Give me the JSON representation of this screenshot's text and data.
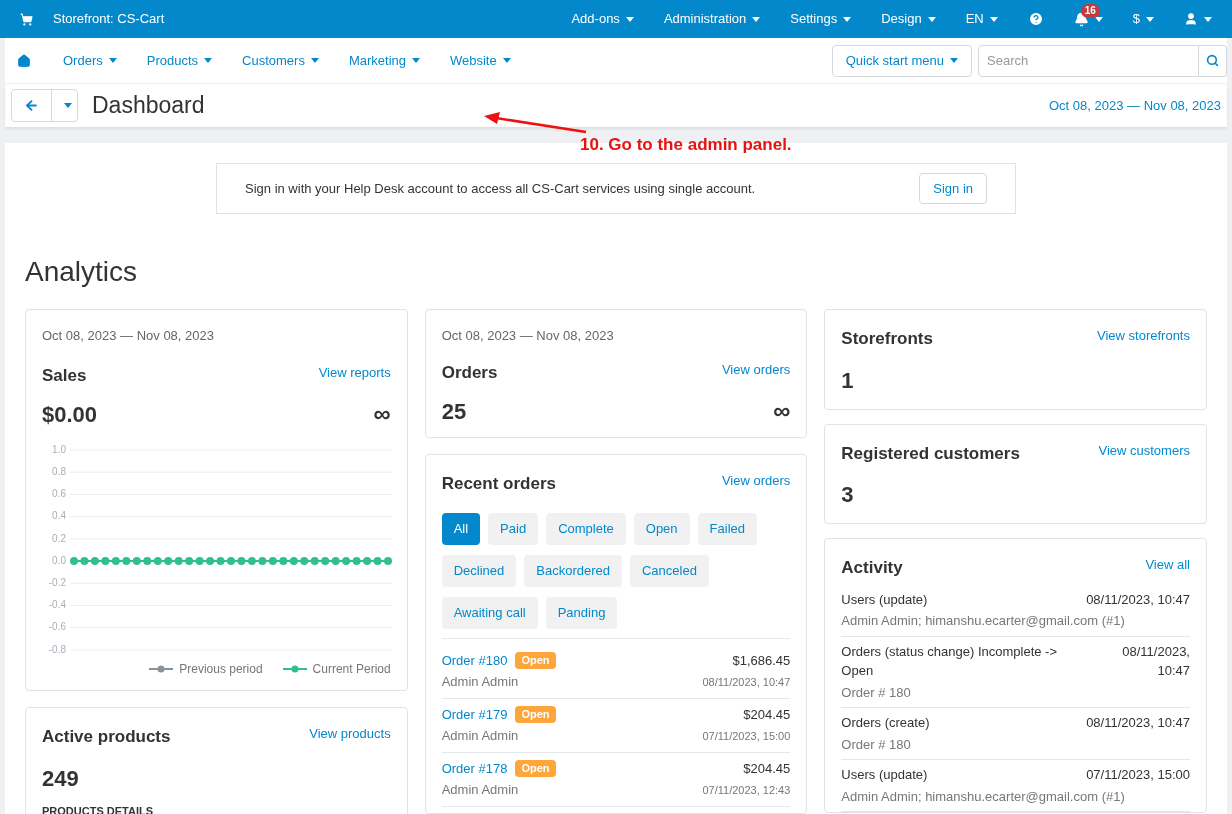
{
  "topbar": {
    "storefront": "Storefront: CS-Cart",
    "menus": [
      "Add-ons",
      "Administration",
      "Settings",
      "Design",
      "EN"
    ],
    "notifications": "16",
    "currency": "$"
  },
  "nav": {
    "items": [
      "Orders",
      "Products",
      "Customers",
      "Marketing",
      "Website"
    ],
    "quick_start": "Quick start menu",
    "search": {
      "placeholder": "Search"
    }
  },
  "header": {
    "title": "Dashboard",
    "date_range": "Oct 08, 2023 — Nov 08, 2023"
  },
  "annotation": {
    "text": "10. Go to the admin panel."
  },
  "signin_banner": {
    "text": "Sign in with your Help Desk account to access all CS-Cart services using single account.",
    "button": "Sign in"
  },
  "section_title": "Analytics",
  "sales": {
    "dates": "Oct 08, 2023 — Nov 08, 2023",
    "title": "Sales",
    "link": "View reports",
    "value": "$0.00",
    "change": "∞",
    "chart_data": {
      "type": "line",
      "ylim": [
        -0.8,
        1
      ],
      "yticks": [
        -0.8,
        -0.6,
        -0.4,
        -0.2,
        {
          "value": 0,
          "label": "0.0"
        },
        0.2,
        0.4,
        0.6,
        0.8,
        {
          "value": 1,
          "label": "1.0"
        }
      ],
      "grid": true,
      "legend": "lower right",
      "series": [
        {
          "name": "Previous period",
          "color": "#8a929a",
          "values": [
            null,
            null,
            null,
            null,
            null,
            null,
            null,
            null,
            null,
            null,
            null,
            null,
            null,
            null,
            null,
            null,
            null,
            null,
            null,
            null,
            null,
            null,
            null,
            null,
            null,
            null,
            null,
            null,
            null,
            null,
            null
          ]
        },
        {
          "name": "Current Period",
          "color": "#2fc08b",
          "marker": "circle",
          "values": [
            0,
            0,
            0,
            0,
            0,
            0,
            0,
            0,
            0,
            0,
            0,
            0,
            0,
            0,
            0,
            0,
            0,
            0,
            0,
            0,
            0,
            0,
            0,
            0,
            0,
            0,
            0,
            0,
            0,
            0,
            0
          ]
        }
      ]
    }
  },
  "active_products": {
    "title": "Active products",
    "link": "View products",
    "value": "249",
    "subtitle": "PRODUCTS DETAILS"
  },
  "orders": {
    "dates": "Oct 08, 2023 — Nov 08, 2023",
    "title": "Orders",
    "link": "View orders",
    "value": "25",
    "change": "∞"
  },
  "recent_orders": {
    "title": "Recent orders",
    "link": "View orders",
    "filters": [
      {
        "label": "All",
        "selected": true
      },
      {
        "label": "Paid",
        "selected": false
      },
      {
        "label": "Complete",
        "selected": false
      },
      {
        "label": "Open",
        "selected": false
      },
      {
        "label": "Failed",
        "selected": false
      },
      {
        "label": "Declined",
        "selected": false
      },
      {
        "label": "Backordered",
        "selected": false
      },
      {
        "label": "Canceled",
        "selected": false
      },
      {
        "label": "Awaiting call",
        "selected": false
      },
      {
        "label": "Panding",
        "selected": false
      }
    ],
    "rows": [
      {
        "order": "Order #180",
        "status": "Open",
        "customer": "Admin Admin",
        "total": "$1,686.45",
        "date": "08/11/2023, 10:47"
      },
      {
        "order": "Order #179",
        "status": "Open",
        "customer": "Admin Admin",
        "total": "$204.45",
        "date": "07/11/2023, 15:00"
      },
      {
        "order": "Order #178",
        "status": "Open",
        "customer": "Admin Admin",
        "total": "$204.45",
        "date": "07/11/2023, 12:43"
      }
    ]
  },
  "storefronts": {
    "title": "Storefronts",
    "link": "View storefronts",
    "value": "1"
  },
  "customers": {
    "title": "Registered customers",
    "link": "View customers",
    "value": "3"
  },
  "activity": {
    "title": "Activity",
    "link": "View all",
    "items": [
      {
        "action": "Users (update)",
        "time": "08/11/2023, 10:47",
        "detail": "Admin Admin; himanshu.ecarter@gmail.com (#1)"
      },
      {
        "action": "Orders (status change) Incomplete -> Open",
        "time": "08/11/2023, 10:47",
        "detail": "Order # 180"
      },
      {
        "action": "Orders (create)",
        "time": "08/11/2023, 10:47",
        "detail": "Order # 180"
      },
      {
        "action": "Users (update)",
        "time": "07/11/2023, 15:00",
        "detail": "Admin Admin; himanshu.ecarter@gmail.com (#1)"
      }
    ]
  }
}
